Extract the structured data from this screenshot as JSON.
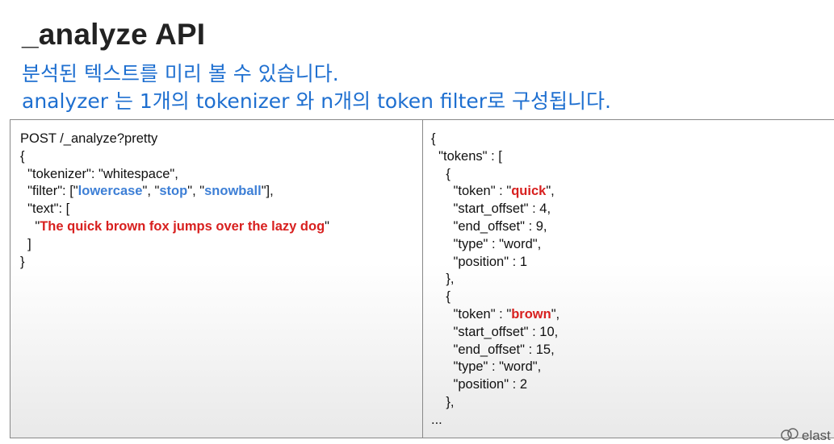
{
  "slide": {
    "title": "_analyze API",
    "subtitle_line1": "분석된 텍스트를 미리 볼 수 있습니다.",
    "subtitle_line2": "analyzer 는 1개의 tokenizer 와 n개의 token filter로 구성됩니다.",
    "logo_text": "elast"
  },
  "request": {
    "line1": "POST /_analyze?pretty",
    "line2": "{",
    "line3": "  \"tokenizer\": \"whitespace\",",
    "filter_prefix": "  \"filter\": [\"",
    "filter_1": "lowercase",
    "filter_sep1": "\", \"",
    "filter_2": "stop",
    "filter_sep2": "\", \"",
    "filter_3": "snowball",
    "filter_suffix": "\"],",
    "line5": "  \"text\": [",
    "text_prefix": "    \"",
    "text_value": "The quick brown fox jumps over the lazy dog",
    "text_suffix": "\"",
    "line7": "  ]",
    "line8": "}"
  },
  "response": {
    "line1": "{",
    "line2": "  \"tokens\" : [",
    "line3": "    {",
    "token1_prefix": "      \"token\" : \"",
    "token1_value": "quick",
    "token1_suffix": "\",",
    "line5": "      \"start_offset\" : 4,",
    "line6": "      \"end_offset\" : 9,",
    "line7": "      \"type\" : \"word\",",
    "line8": "      \"position\" : 1",
    "line9": "    },",
    "line10": "    {",
    "token2_prefix": "      \"token\" : \"",
    "token2_value": "brown",
    "token2_suffix": "\",",
    "line12": "      \"start_offset\" : 10,",
    "line13": "      \"end_offset\" : 15,",
    "line14": "      \"type\" : \"word\",",
    "line15": "      \"position\" : 2",
    "line16": "    },",
    "line17": "..."
  },
  "colors": {
    "accent_blue": "#1e6fd0",
    "filter_blue": "#3d7fd6",
    "highlight_red": "#d8201f"
  }
}
